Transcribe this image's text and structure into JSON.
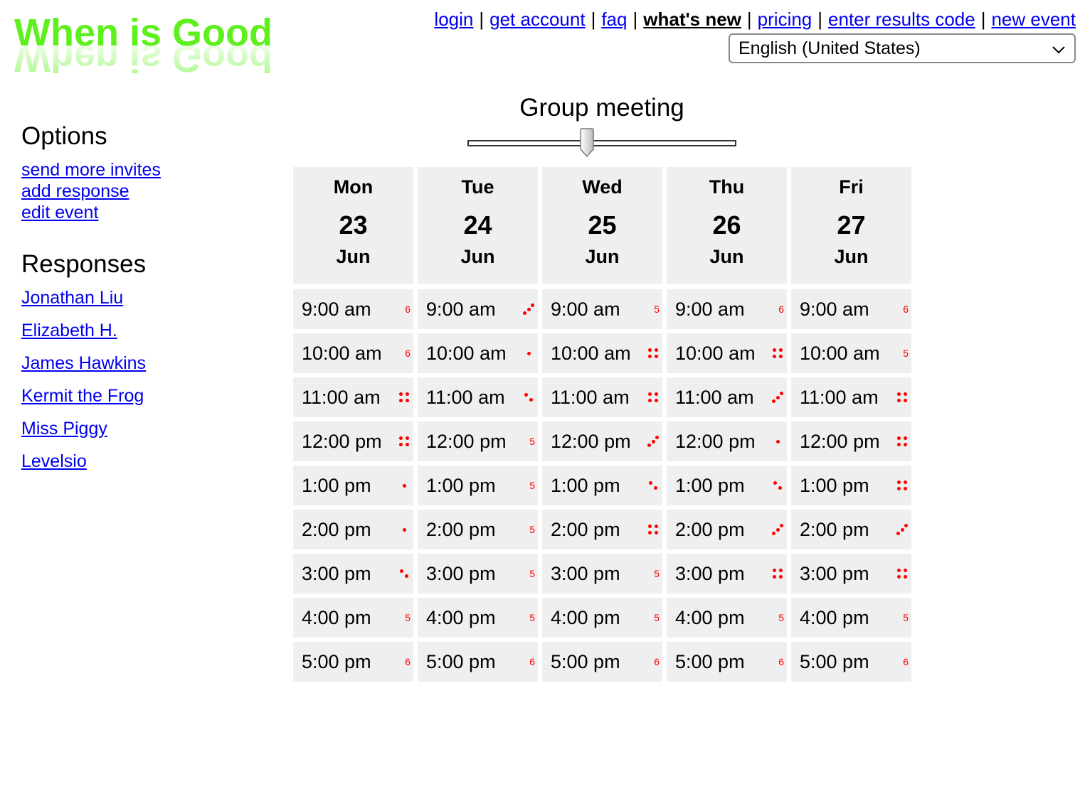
{
  "logo": {
    "text": "When is Good"
  },
  "nav": {
    "links": [
      "login",
      "get account",
      "faq",
      "what's new",
      "pricing",
      "enter results code",
      "new event"
    ],
    "current": "what's new"
  },
  "language": {
    "selected": "English (United States)"
  },
  "sidebar": {
    "options_heading": "Options",
    "options": [
      "send more invites",
      "add response",
      "edit event"
    ],
    "responses_heading": "Responses",
    "responses": [
      "Jonathan Liu",
      "Elizabeth H.",
      "James Hawkins",
      "Kermit the Frog",
      "Miss Piggy",
      "Levelsio"
    ]
  },
  "event": {
    "title": "Group meeting",
    "slider_level": 0.445
  },
  "calendar": {
    "days": [
      {
        "dow": "Mon",
        "date": "23",
        "month": "Jun"
      },
      {
        "dow": "Tue",
        "date": "24",
        "month": "Jun"
      },
      {
        "dow": "Wed",
        "date": "25",
        "month": "Jun"
      },
      {
        "dow": "Thu",
        "date": "26",
        "month": "Jun"
      },
      {
        "dow": "Fri",
        "date": "27",
        "month": "Jun"
      }
    ],
    "times": [
      "9:00 am",
      "10:00 am",
      "11:00 am",
      "12:00 pm",
      "1:00 pm",
      "2:00 pm",
      "3:00 pm",
      "4:00 pm",
      "5:00 pm"
    ],
    "counts": [
      [
        "6",
        "3",
        "5",
        "6",
        "6"
      ],
      [
        "6",
        "1",
        "4",
        "4",
        "5"
      ],
      [
        "4",
        "2",
        "4",
        "3",
        "4"
      ],
      [
        "4",
        "5",
        "3",
        "1",
        "4"
      ],
      [
        "1",
        "5",
        "2",
        "2",
        "4"
      ],
      [
        "1",
        "5",
        "4",
        "3",
        "3"
      ],
      [
        "2",
        "5",
        "5",
        "4",
        "4"
      ],
      [
        "5",
        "5",
        "5",
        "5",
        "5"
      ],
      [
        "6",
        "6",
        "6",
        "6",
        "6"
      ]
    ],
    "indicator_color": "#ff0000",
    "cell_color": "#efefef"
  }
}
